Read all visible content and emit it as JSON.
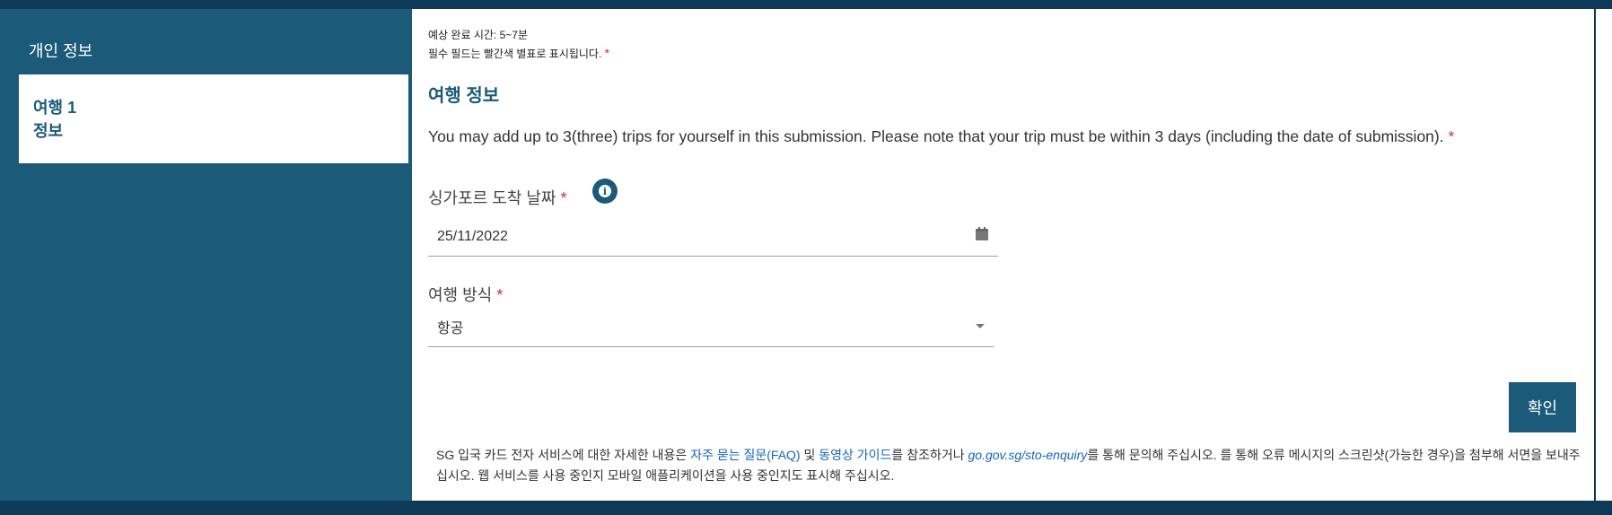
{
  "sidebar": {
    "step1_label": "개인 정보",
    "step2_line1": "여행 1",
    "step2_line2": "정보"
  },
  "header": {
    "estimated_time": "예상 완료 시간: 5~7분",
    "required_note": "필수 필드는 빨간색 별표로 표시됩니다.",
    "required_mark": "*"
  },
  "section": {
    "title": "여행 정보",
    "note": "You may add up to 3(three) trips for yourself in this submission. Please note that your trip must be within 3 days (including the date of submission)."
  },
  "arrival_date": {
    "label": "싱가포르 도착 날짜",
    "value": "25/11/2022",
    "info_icon": "i"
  },
  "travel_mode": {
    "label": "여행 방식",
    "value": "항공"
  },
  "confirm_button": "확인",
  "footer": {
    "text1": "SG 입국 카드 전자 서비스에 대한 자세한 내용은 ",
    "link_faq": "자주 묻는 질문(FAQ)",
    "text2": " 및 ",
    "link_video": "동영상 가이드",
    "text3": "를 참조하거나 ",
    "link_enquiry": "go.gov.sg/sto-enquiry",
    "text4": "를 통해 문의해 주십시오. 를 통해 오류 메시지의 스크린샷(가능한 경우)을 첨부해 서면을 보내주십시오. 웹 서비스를 사용 중인지 모바일 애플리케이션을 사용 중인지도 표시해 주십시오."
  },
  "colors": {
    "accent": "#1b5a78",
    "dark": "#0f3a57",
    "required": "#d32f2f",
    "link": "#1565c0"
  },
  "icons": [
    "info-icon",
    "calendar-icon",
    "chevron-down-icon"
  ]
}
